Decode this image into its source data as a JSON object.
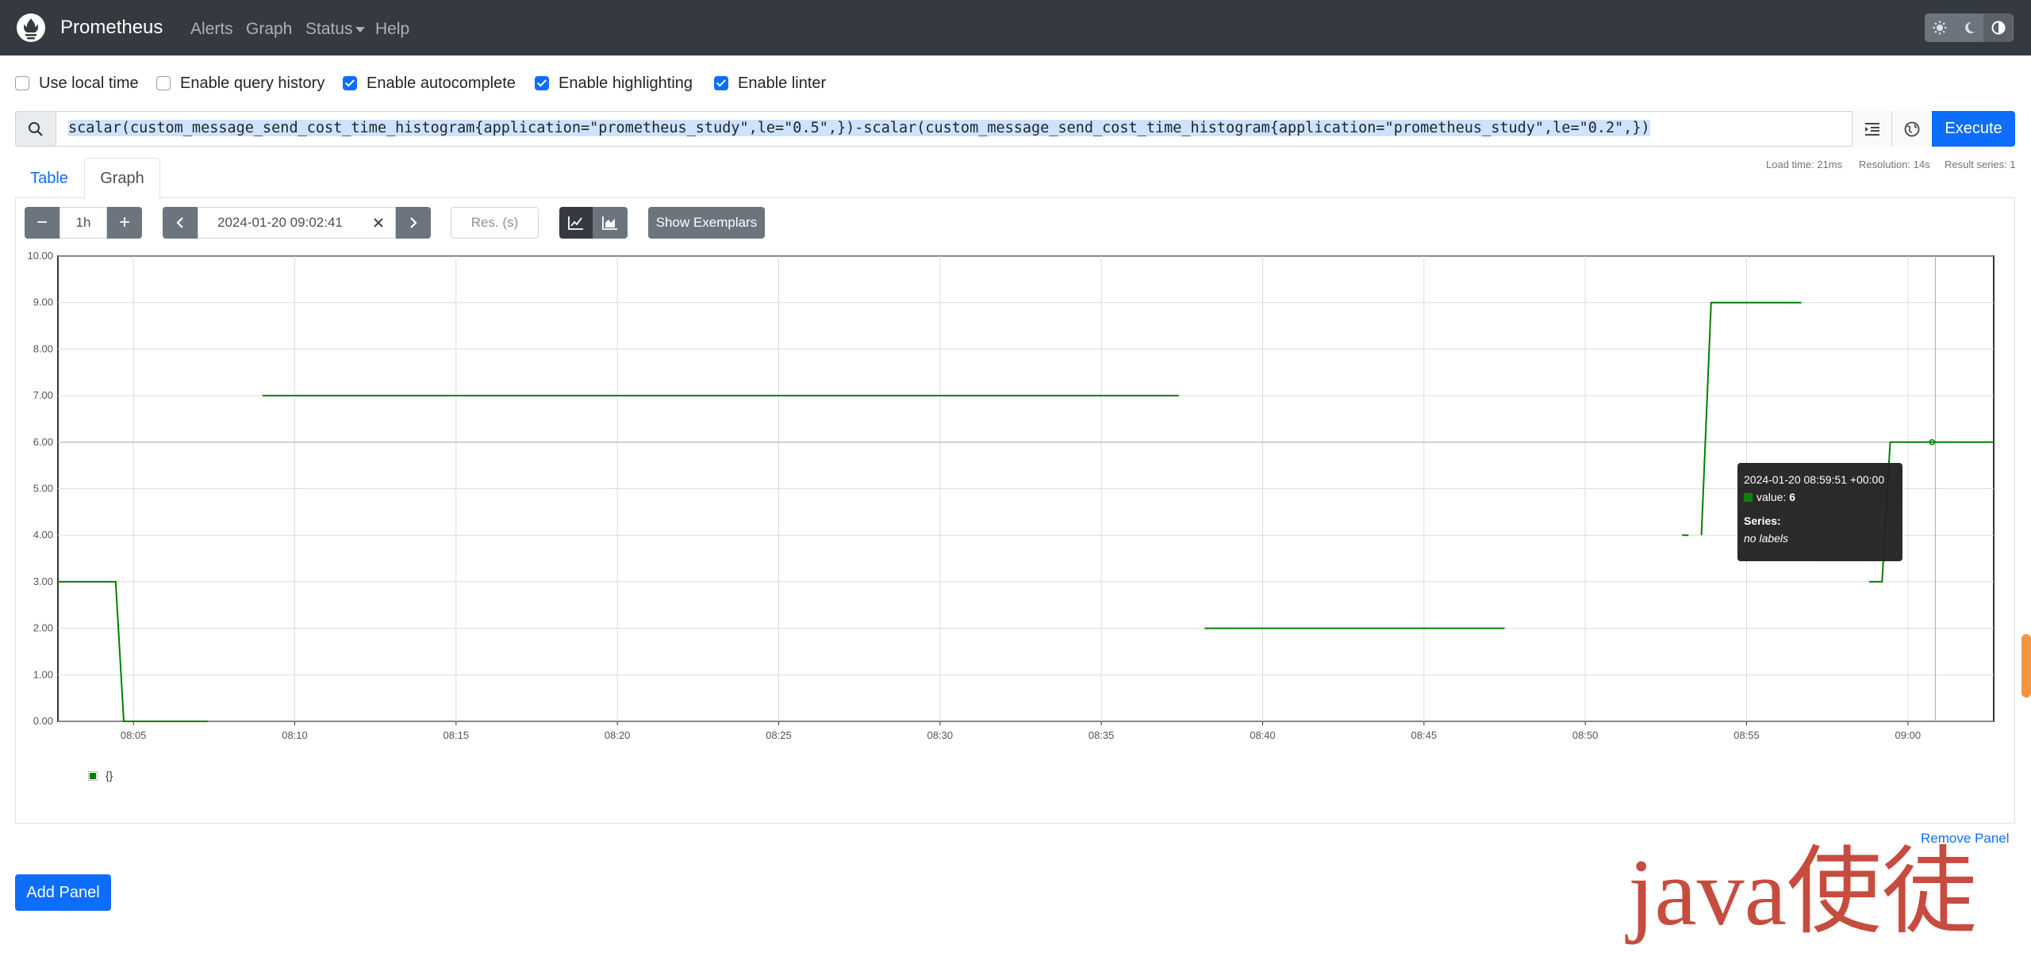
{
  "navbar": {
    "brand": "Prometheus",
    "links": [
      "Alerts",
      "Graph",
      "Status",
      "Help"
    ]
  },
  "options": {
    "local_time": {
      "label": "Use local time",
      "checked": false
    },
    "query_history": {
      "label": "Enable query history",
      "checked": false
    },
    "autocomplete": {
      "label": "Enable autocomplete",
      "checked": true
    },
    "highlighting": {
      "label": "Enable highlighting",
      "checked": true
    },
    "linter": {
      "label": "Enable linter",
      "checked": true
    }
  },
  "query": {
    "expression": "scalar(custom_message_send_cost_time_histogram{application=\"prometheus_study\",le=\"0.5\",})-scalar(custom_message_send_cost_time_histogram{application=\"prometheus_study\",le=\"0.2\",})",
    "execute_label": "Execute"
  },
  "tabs": {
    "table": "Table",
    "graph": "Graph"
  },
  "stats": {
    "load_time": "Load time: 21ms",
    "resolution": "Resolution: 14s",
    "result_series": "Result series: 1"
  },
  "controls": {
    "minus": "−",
    "range": "1h",
    "plus": "+",
    "end_time": "2024-01-20 09:02:41",
    "res_placeholder": "Res. (s)",
    "show_exemplars": "Show Exemplars"
  },
  "chart_data": {
    "type": "line",
    "x_ticks": [
      "08:05",
      "08:10",
      "08:15",
      "08:20",
      "08:25",
      "08:30",
      "08:35",
      "08:40",
      "08:45",
      "08:50",
      "08:55",
      "09:00"
    ],
    "y_ticks": [
      "0.00",
      "1.00",
      "2.00",
      "3.00",
      "4.00",
      "5.00",
      "6.00",
      "7.00",
      "8.00",
      "9.00",
      "10.00"
    ],
    "ylim": [
      0,
      10
    ],
    "xlim_minutes": [
      -2.34,
      57.66
    ],
    "series": [
      {
        "name": "{}",
        "color": "#008000",
        "segments": [
          [
            [
              -2.34,
              3
            ],
            [
              -0.55,
              3
            ],
            [
              -0.3,
              0
            ],
            [
              2.3,
              0
            ]
          ],
          [
            [
              4.0,
              7
            ],
            [
              32.4,
              7
            ]
          ],
          [
            [
              33.2,
              2
            ],
            [
              42.5,
              2
            ]
          ],
          [
            [
              48.0,
              4
            ],
            [
              48.2,
              4
            ]
          ],
          [
            [
              48.6,
              4
            ],
            [
              48.9,
              9
            ],
            [
              51.7,
              9
            ]
          ],
          [
            [
              53.8,
              3
            ],
            [
              54.2,
              3
            ],
            [
              54.45,
              6
            ],
            [
              57.66,
              6
            ]
          ]
        ]
      }
    ],
    "hover_x_minute": 55.85
  },
  "tooltip": {
    "time": "2024-01-20 08:59:51 +00:00",
    "value_label": "value:",
    "value": "6",
    "series_label": "Series:",
    "series_value": "no labels"
  },
  "legend": {
    "label": "{}"
  },
  "remove_panel": "Remove Panel",
  "add_panel": "Add Panel",
  "watermark": "java使徒"
}
